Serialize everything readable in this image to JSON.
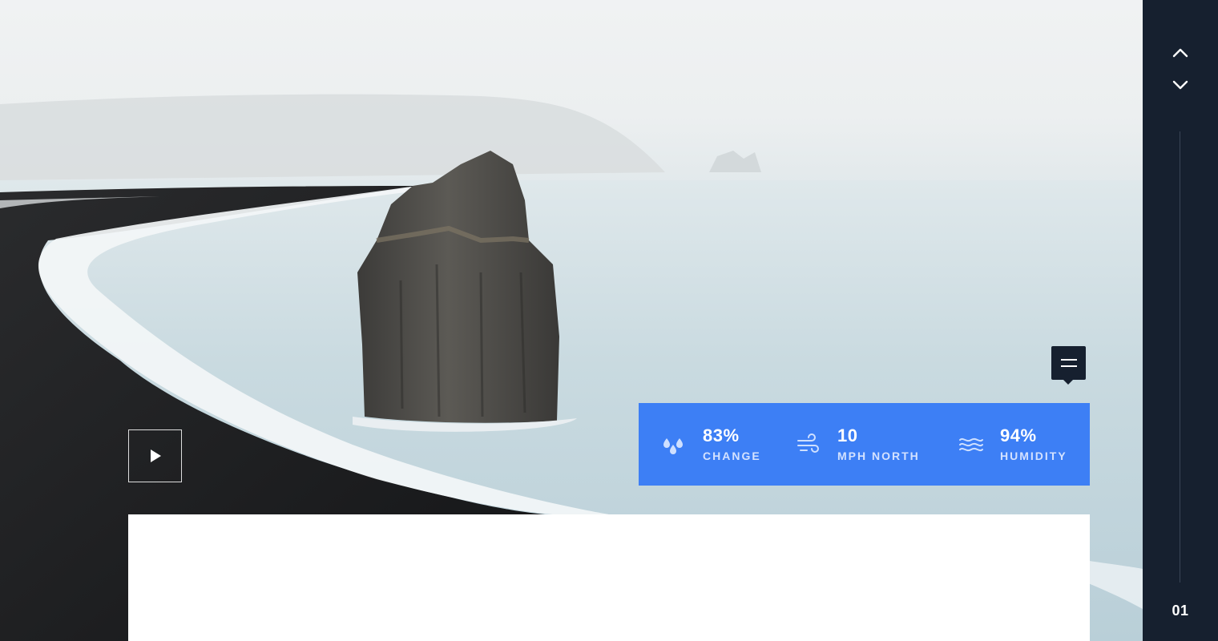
{
  "weather": {
    "chance": {
      "value": "83%",
      "label": "CHANGE",
      "icon": "raindrops-icon"
    },
    "wind": {
      "value": "10",
      "label": "MPH NORTH",
      "icon": "wind-icon"
    },
    "humidity": {
      "value": "94%",
      "label": "HUMIDITY",
      "icon": "waves-icon"
    }
  },
  "sidebar": {
    "up_icon": "chevron-up-icon",
    "down_icon": "chevron-down-icon",
    "page_number": "01"
  },
  "controls": {
    "play_icon": "play-icon",
    "menu_icon": "menu-icon"
  },
  "colors": {
    "accent": "#3d7ff5",
    "dark": "#16202f",
    "card": "#ffffff"
  }
}
